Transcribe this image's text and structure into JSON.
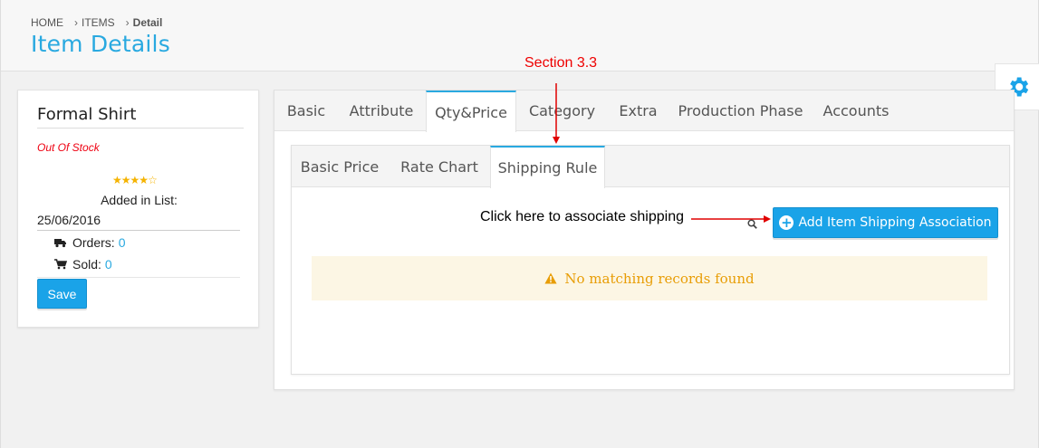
{
  "breadcrumb": {
    "home": "HOME",
    "items": "ITEMS",
    "current": "Detail"
  },
  "page_title": "Item Details",
  "annotations": {
    "section": "Section 3.3",
    "hint": "Click here to associate shipping"
  },
  "item": {
    "name": "Formal Shirt",
    "stock_status": "Out Of Stock",
    "rating_stars": 4,
    "rating_max": 5,
    "added_label": "Added in List:",
    "added_date": "25/06/2016",
    "orders_label": "Orders:",
    "orders_count": "0",
    "sold_label": "Sold:",
    "sold_count": "0",
    "save_label": "Save"
  },
  "tabs": [
    {
      "label": "Basic"
    },
    {
      "label": "Attribute"
    },
    {
      "label": "Qty&Price"
    },
    {
      "label": "Category"
    },
    {
      "label": "Extra"
    },
    {
      "label": "Production Phase"
    },
    {
      "label": "Accounts"
    }
  ],
  "active_tab": "Qty&Price",
  "subtabs": [
    {
      "label": "Basic Price"
    },
    {
      "label": "Rate Chart"
    },
    {
      "label": "Shipping Rule"
    }
  ],
  "active_subtab": "Shipping Rule",
  "shipping": {
    "add_button_label": "Add Item Shipping Association",
    "empty_message": "No matching records found"
  },
  "colors": {
    "accent": "#29a9e0",
    "button": "#1aa3e8",
    "annotation_red": "#e00000",
    "warning_text": "#e89d05",
    "warning_bg": "#fcf6e4",
    "star": "#f5b300"
  },
  "icons": {
    "settings": "gear-icon",
    "orders": "truck-icon",
    "sold": "cart-icon",
    "add": "plus-circle-icon",
    "warning": "warning-icon",
    "search": "search-icon"
  }
}
